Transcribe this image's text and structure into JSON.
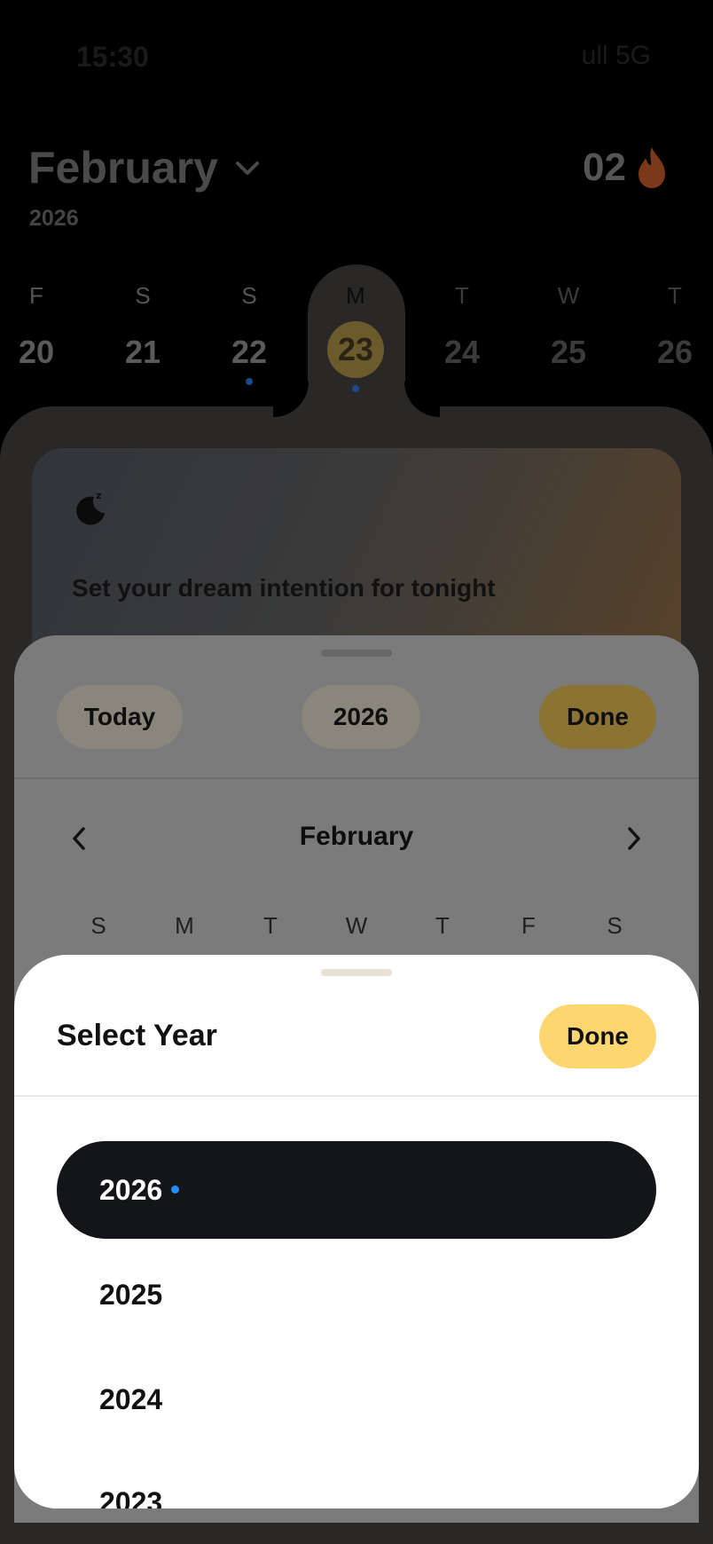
{
  "status_bar": {
    "time": "15:30",
    "indicators": "ull 5G"
  },
  "header": {
    "month": "February",
    "year": "2026",
    "streak": "02",
    "streak_icon": "flame-icon"
  },
  "week": [
    {
      "letter": "F",
      "num": "20",
      "dot": false,
      "state": "normal"
    },
    {
      "letter": "S",
      "num": "21",
      "dot": false,
      "state": "normal"
    },
    {
      "letter": "S",
      "num": "22",
      "dot": true,
      "state": "normal"
    },
    {
      "letter": "M",
      "num": "23",
      "dot": true,
      "state": "selected"
    },
    {
      "letter": "T",
      "num": "24",
      "dot": false,
      "state": "faded"
    },
    {
      "letter": "W",
      "num": "25",
      "dot": false,
      "state": "faded"
    },
    {
      "letter": "T",
      "num": "26",
      "dot": false,
      "state": "faded"
    }
  ],
  "intention_card": {
    "icon": "moon-sleep-icon",
    "text": "Set your dream intention for tonight"
  },
  "date_picker": {
    "today_label": "Today",
    "year_label": "2026",
    "done_label": "Done",
    "month": "February",
    "weekdays": [
      "S",
      "M",
      "T",
      "W",
      "T",
      "F",
      "S"
    ]
  },
  "year_picker": {
    "title": "Select Year",
    "done_label": "Done",
    "years": [
      "2026",
      "2025",
      "2024",
      "2023"
    ],
    "selected": "2026"
  },
  "colors": {
    "accent": "#fdd670",
    "selected_row": "#141519",
    "indicator_dot": "#1e90ff"
  }
}
